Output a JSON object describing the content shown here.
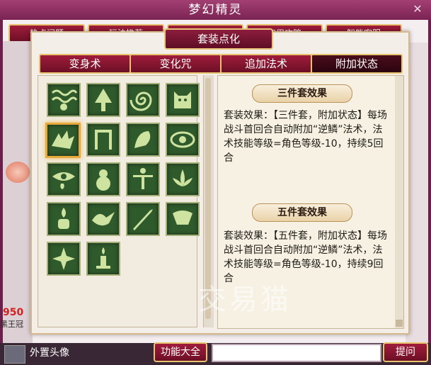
{
  "window": {
    "title": "梦幻精灵"
  },
  "background_tabs": [
    "热点问题",
    "玩法推荐",
    "新手指引",
    "实用攻略",
    "智能客服"
  ],
  "dialog": {
    "title": "套装点化",
    "tabs": [
      {
        "label": "变身术",
        "active": false
      },
      {
        "label": "变化咒",
        "active": false
      },
      {
        "label": "追加法术",
        "active": false
      },
      {
        "label": "附加状态",
        "active": true
      }
    ],
    "skills": [
      {
        "icon": "wave-icon",
        "selected": false
      },
      {
        "icon": "tree-icon",
        "selected": false
      },
      {
        "icon": "spiral-icon",
        "selected": false
      },
      {
        "icon": "beast-icon",
        "selected": false
      },
      {
        "icon": "dragon-icon",
        "selected": true
      },
      {
        "icon": "gate-icon",
        "selected": false
      },
      {
        "icon": "claw-icon",
        "selected": false
      },
      {
        "icon": "eye-icon",
        "selected": false
      },
      {
        "icon": "tear-eye-icon",
        "selected": false
      },
      {
        "icon": "gourd-icon",
        "selected": false
      },
      {
        "icon": "bound-figure-icon",
        "selected": false
      },
      {
        "icon": "lotus-icon",
        "selected": false
      },
      {
        "icon": "flame-vase-icon",
        "selected": false
      },
      {
        "icon": "bird-icon",
        "selected": false
      },
      {
        "icon": "sword-icon",
        "selected": false
      },
      {
        "icon": "kneel-icon",
        "selected": false
      },
      {
        "icon": "star-icon",
        "selected": false
      },
      {
        "icon": "candle-icon",
        "selected": false
      }
    ],
    "effects": [
      {
        "title": "三件套效果",
        "text": "套装效果：【三件套，附加状态】每场战斗首回合自动附加“逆鳞”法术，法术技能等级=角色等级-10，持续5回合"
      },
      {
        "title": "五件套效果",
        "text": "套装效果：【五件套，附加状态】每场战斗首回合自动附加“逆鳞”法术，法术技能等级=角色等级-10，持续9回合"
      }
    ]
  },
  "sidebar": {
    "hp_digits": "950",
    "sub_label": "黑王冠"
  },
  "bottom": {
    "external_avatar_label": "外置头像",
    "function_button": "功能大全",
    "ask_button": "提问"
  },
  "watermark": "交易猫",
  "colors": {
    "accent": "#7a2452",
    "button": "#8c1d3d",
    "gold_border": "#e7c36f",
    "skill_bg": "#2f5a2c",
    "selected": "#e8a93c"
  }
}
